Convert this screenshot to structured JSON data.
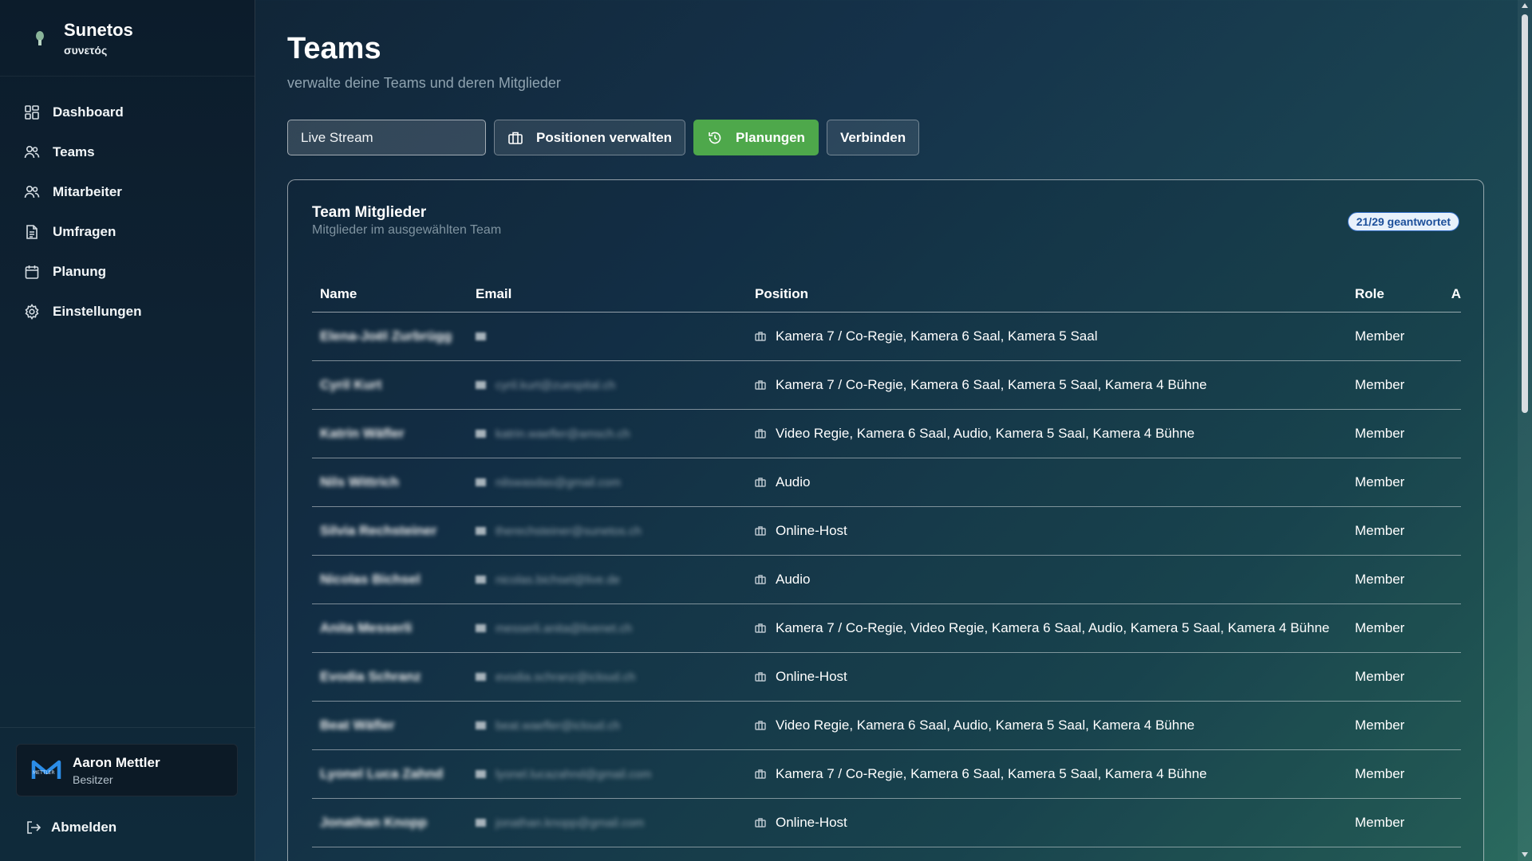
{
  "brand": {
    "title": "Sunetos",
    "subtitle": "συνετός"
  },
  "nav": [
    {
      "label": "Dashboard",
      "icon": "dashboard-icon"
    },
    {
      "label": "Teams",
      "icon": "users-icon"
    },
    {
      "label": "Mitarbeiter",
      "icon": "users-icon"
    },
    {
      "label": "Umfragen",
      "icon": "document-icon"
    },
    {
      "label": "Planung",
      "icon": "calendar-icon"
    },
    {
      "label": "Einstellungen",
      "icon": "gear-icon"
    }
  ],
  "user": {
    "name": "Aaron Mettler",
    "role": "Besitzer"
  },
  "logout_label": "Abmelden",
  "page": {
    "title": "Teams",
    "subtitle": "verwalte deine Teams und deren Mitglieder"
  },
  "toolbar": {
    "team_select": "Live Stream",
    "positions_label": "Positionen verwalten",
    "planning_label": "Planungen",
    "connect_label": "Verbinden"
  },
  "members": {
    "title": "Team Mitglieder",
    "subtitle": "Mitglieder im ausgewählten Team",
    "badge": "21/29 geantwortet",
    "columns": {
      "name": "Name",
      "email": "Email",
      "position": "Position",
      "role": "Role",
      "extra": "A"
    },
    "rows": [
      {
        "name": "Elena-Joël Zurbrügg",
        "email": "",
        "position": "Kamera 7 / Co-Regie, Kamera 6 Saal, Kamera 5 Saal",
        "role": "Member"
      },
      {
        "name": "Cyril Kurt",
        "email": "cyril.kurt@zuespital.ch",
        "position": "Kamera 7 / Co-Regie, Kamera 6 Saal, Kamera 5 Saal, Kamera 4 Bühne",
        "role": "Member"
      },
      {
        "name": "Katrin Wäfler",
        "email": "katrin.waefler@amsch.ch",
        "position": "Video Regie, Kamera 6 Saal, Audio, Kamera 5 Saal, Kamera 4 Bühne",
        "role": "Member"
      },
      {
        "name": "Nils Wittrich",
        "email": "nilswasdas@gmail.com",
        "position": "Audio",
        "role": "Member"
      },
      {
        "name": "Silvia Rechsteiner",
        "email": "therechsteiner@sunetos.ch",
        "position": "Online-Host",
        "role": "Member"
      },
      {
        "name": "Nicolas Bichsel",
        "email": "nicolas.bichsel@live.de",
        "position": "Audio",
        "role": "Member"
      },
      {
        "name": "Anita Messerli",
        "email": "messerli.anita@livenet.ch",
        "position": "Kamera 7 / Co-Regie, Video Regie, Kamera 6 Saal, Audio, Kamera 5 Saal, Kamera 4 Bühne",
        "role": "Member"
      },
      {
        "name": "Evodia Schranz",
        "email": "evodia.schranz@icloud.ch",
        "position": "Online-Host",
        "role": "Member"
      },
      {
        "name": "Beat Wäfler",
        "email": "beat.waefler@icloud.ch",
        "position": "Video Regie, Kamera 6 Saal, Audio, Kamera 5 Saal, Kamera 4 Bühne",
        "role": "Member"
      },
      {
        "name": "Lyonel Luca Zahnd",
        "email": "lyonel.lucazahnd@gmail.com",
        "position": "Kamera 7 / Co-Regie, Kamera 6 Saal, Kamera 5 Saal, Kamera 4 Bühne",
        "role": "Member"
      },
      {
        "name": "Jonathan Knopp",
        "email": "jonathan.knopp@gmail.com",
        "position": "Online-Host",
        "role": "Member"
      }
    ]
  },
  "colors": {
    "accent_green": "#4ea84b",
    "badge_text": "#1c4f9a",
    "badge_bg": "#e8f1fb"
  }
}
